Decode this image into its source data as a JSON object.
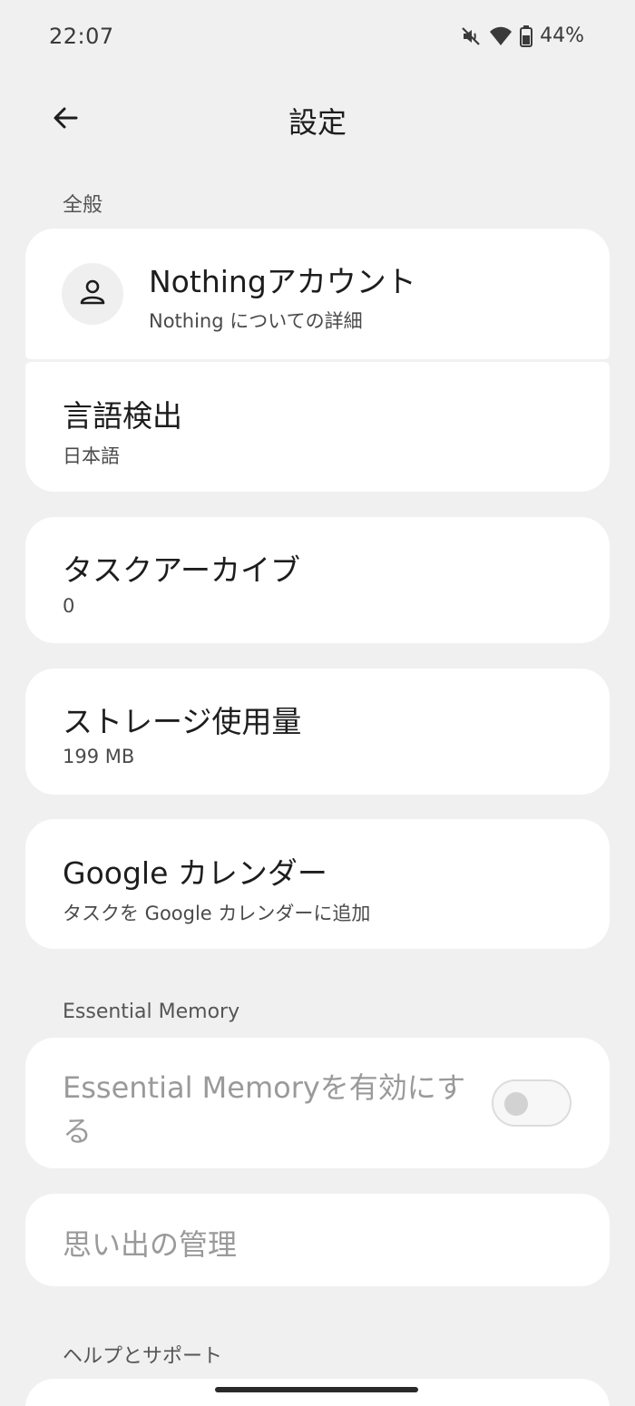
{
  "status_bar": {
    "time": "22:07",
    "battery_percent": "44%",
    "icons": [
      "mute-icon",
      "wifi-icon",
      "battery-icon"
    ]
  },
  "app_bar": {
    "back_icon": "arrow-left-icon",
    "title": "設定"
  },
  "sections": {
    "general": {
      "label": "全般",
      "account": {
        "title": "Nothingアカウント",
        "subtitle": "Nothing についての詳細",
        "icon": "person-icon"
      },
      "language": {
        "title": "言語検出",
        "subtitle": "日本語"
      },
      "archive": {
        "title": "タスクアーカイブ",
        "subtitle": "0"
      },
      "storage": {
        "title": "ストレージ使用量",
        "subtitle": "199 MB"
      },
      "calendar": {
        "title": "Google カレンダー",
        "subtitle": "タスクを Google カレンダーに追加"
      }
    },
    "memory": {
      "label": "Essential Memory",
      "enable": {
        "title_line1": "Essential Memoryを有効にす",
        "title_line2": "る",
        "toggle_state": "off"
      },
      "manage": {
        "title": "思い出の管理"
      }
    },
    "help": {
      "label": "ヘルプとサポート"
    }
  },
  "colors": {
    "background": "#f0f0f0",
    "card": "#ffffff",
    "disabled_text": "#9a9a9a"
  }
}
